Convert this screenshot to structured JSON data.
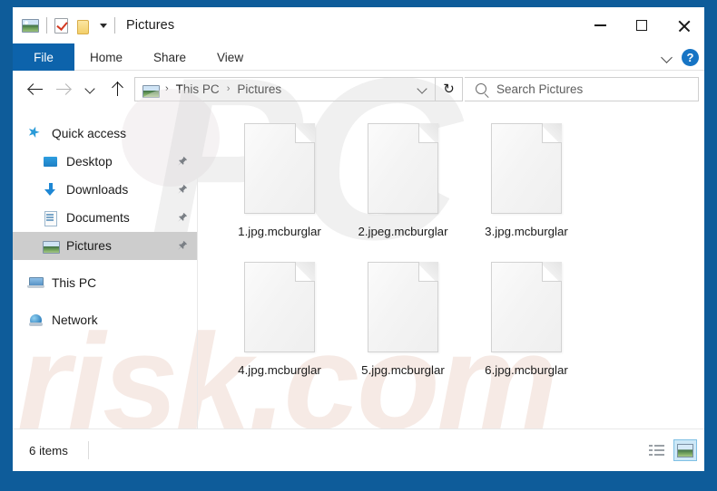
{
  "window": {
    "title": "Pictures",
    "quick_access_icons": [
      "picture-icon",
      "properties-icon",
      "new-folder-icon",
      "customize-caret-icon"
    ],
    "controls": {
      "minimize": "—",
      "maximize": "□",
      "close": "✕"
    }
  },
  "ribbon": {
    "tabs": [
      {
        "label": "File",
        "active": true
      },
      {
        "label": "Home",
        "active": false
      },
      {
        "label": "Share",
        "active": false
      },
      {
        "label": "View",
        "active": false
      }
    ],
    "expand_label": "⌄",
    "help_label": "?"
  },
  "address": {
    "back": "←",
    "forward": "→",
    "recent": "⌄",
    "up": "↑",
    "breadcrumb": [
      "This PC",
      "Pictures"
    ],
    "separator": "›",
    "dropdown": "⌄",
    "refresh": "↻"
  },
  "search": {
    "placeholder": "Search Pictures",
    "icon": "search-icon"
  },
  "sidebar": {
    "items": [
      {
        "label": "Quick access",
        "icon": "star-icon",
        "indent": false,
        "pinned": false,
        "selected": false
      },
      {
        "label": "Desktop",
        "icon": "desktop-icon",
        "indent": true,
        "pinned": true,
        "selected": false
      },
      {
        "label": "Downloads",
        "icon": "downloads-icon",
        "indent": true,
        "pinned": true,
        "selected": false
      },
      {
        "label": "Documents",
        "icon": "documents-icon",
        "indent": true,
        "pinned": true,
        "selected": false
      },
      {
        "label": "Pictures",
        "icon": "pictures-icon",
        "indent": true,
        "pinned": true,
        "selected": true
      },
      {
        "label": "This PC",
        "icon": "this-pc-icon",
        "indent": false,
        "pinned": false,
        "selected": false
      },
      {
        "label": "Network",
        "icon": "network-icon",
        "indent": false,
        "pinned": false,
        "selected": false
      }
    ],
    "pin_glyph": "📌"
  },
  "files": [
    {
      "name": "1.jpg.mcburglar"
    },
    {
      "name": "2.jpeg.mcburglar"
    },
    {
      "name": "3.jpg.mcburglar"
    },
    {
      "name": "4.jpg.mcburglar"
    },
    {
      "name": "5.jpg.mcburglar"
    },
    {
      "name": "6.jpg.mcburglar"
    }
  ],
  "status": {
    "item_count": "6 items",
    "view_details_label": "details-view",
    "view_thumbnails_label": "large-icons-view"
  },
  "watermark": {
    "top_text": "PC",
    "bottom_text": "risk.com"
  },
  "colors": {
    "frame_blue": "#0e5c9a",
    "file_tab_blue": "#0d63ab",
    "help_blue": "#1674c4",
    "selection_gray": "#cdcdcd",
    "active_view_blue": "#cde8f7"
  }
}
